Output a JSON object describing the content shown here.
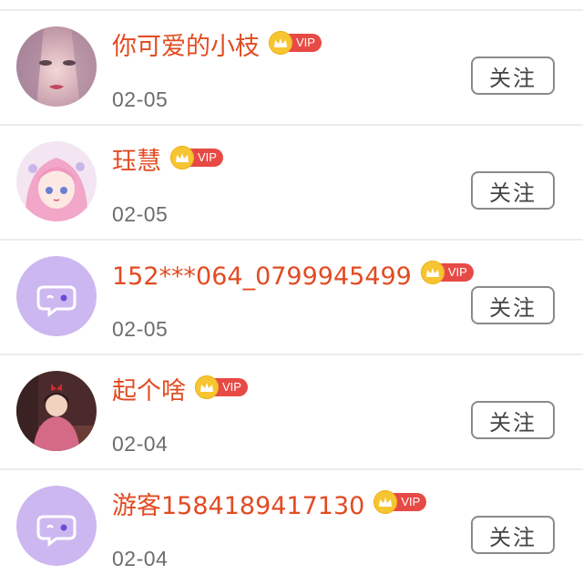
{
  "users": [
    {
      "name": "你可爱的小枝",
      "vip_label": "VIP",
      "date": "02-05",
      "follow_label": "关注",
      "avatar": "photo-avatar-girl"
    },
    {
      "name": "珏慧",
      "vip_label": "VIP",
      "date": "02-05",
      "follow_label": "关注",
      "avatar": "anime-avatar-pink-hair"
    },
    {
      "name": "152***064_0799945499",
      "vip_label": "VIP",
      "date": "02-05",
      "follow_label": "关注",
      "avatar": "default-chat-avatar"
    },
    {
      "name": "起个啥",
      "vip_label": "VIP",
      "date": "02-04",
      "follow_label": "关注",
      "avatar": "anime-avatar-witch"
    },
    {
      "name": "游客1584189417130",
      "vip_label": "VIP",
      "date": "02-04",
      "follow_label": "关注",
      "avatar": "default-chat-avatar"
    }
  ],
  "colors": {
    "name": "#e24b22",
    "vip_badge": "#e74a45",
    "crown": "#f7c531",
    "default_avatar_bg": "#cdb7f0"
  }
}
